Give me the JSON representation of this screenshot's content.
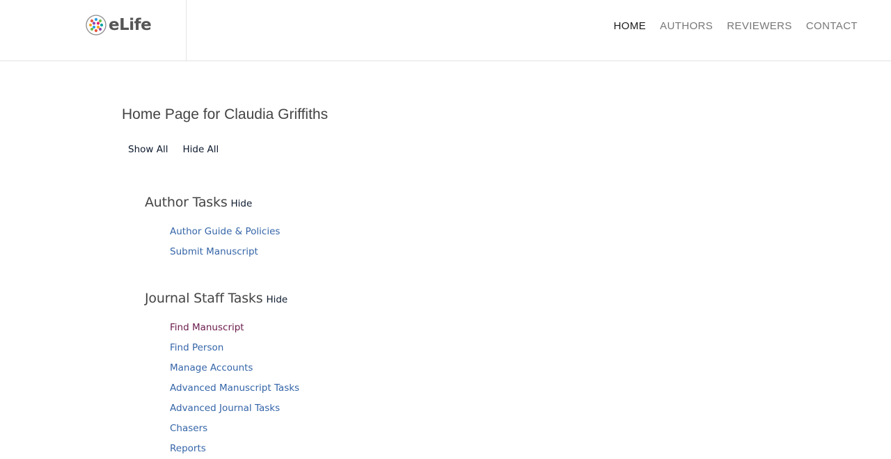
{
  "header": {
    "logo_text": "eLife",
    "nav": [
      {
        "label": "HOME",
        "active": true
      },
      {
        "label": "AUTHORS",
        "active": false
      },
      {
        "label": "REVIEWERS",
        "active": false
      },
      {
        "label": "CONTACT",
        "active": false
      }
    ]
  },
  "main": {
    "title": "Home Page for Claudia Griffiths",
    "show_all": "Show All",
    "hide_all": "Hide All",
    "sections": [
      {
        "title": "Author Tasks",
        "toggle": "Hide",
        "items": [
          "Author Guide & Policies",
          "Submit Manuscript"
        ]
      },
      {
        "title": "Journal Staff Tasks",
        "toggle": "Hide",
        "items": [
          "Find Manuscript",
          "Find Person",
          "Manage Accounts",
          "Advanced Manuscript Tasks",
          "Advanced Journal Tasks",
          "Chasers",
          "Reports"
        ]
      }
    ]
  },
  "colors": {
    "link": "#3565a8",
    "visited_link": "#6a1b4d",
    "nav_active": "#1a1a1a",
    "nav_inactive": "#777777",
    "heading": "#444444"
  }
}
